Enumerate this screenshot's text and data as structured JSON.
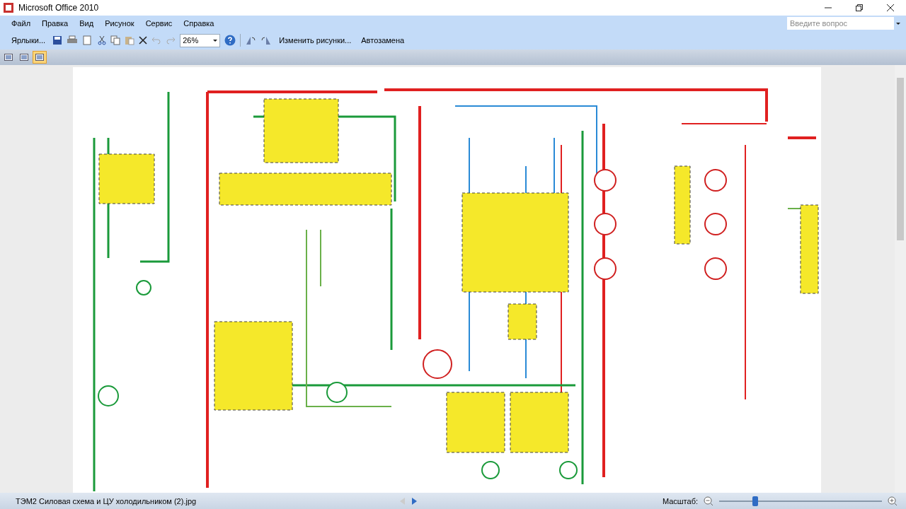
{
  "window": {
    "title": "Microsoft Office 2010"
  },
  "menu": [
    "Файл",
    "Правка",
    "Вид",
    "Рисунок",
    "Сервис",
    "Справка"
  ],
  "help_search": {
    "placeholder": "Введите вопрос"
  },
  "toolbar": {
    "shortcuts": "Ярлыки...",
    "zoom": "26%",
    "edit_pictures": "Изменить рисунки...",
    "autocorrect": "Автозамена"
  },
  "view_buttons": [
    {
      "selected": false
    },
    {
      "selected": false
    },
    {
      "selected": true
    }
  ],
  "status_bar": {
    "file_name": "ТЭМ2 Силовая схема и ЦУ холодильником (2).jpg",
    "zoom_label": "Масштаб:",
    "zoom_slider": {
      "level": 0.22
    }
  }
}
